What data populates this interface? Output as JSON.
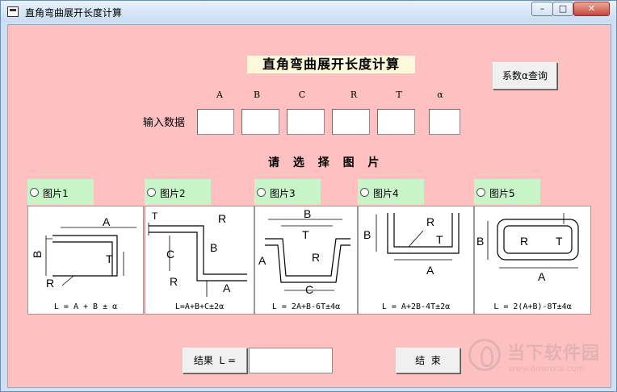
{
  "window": {
    "title": "直角弯曲展开长度计算",
    "min_glyph": "–",
    "max_glyph": "□",
    "close_glyph": "✕"
  },
  "form": {
    "heading": "直角弯曲展开长度计算",
    "query_button": "系数α查询",
    "column_labels": [
      "A",
      "B",
      "C",
      "R",
      "T",
      "α"
    ],
    "input_label": "输入数据",
    "inputs": [
      "",
      "",
      "",
      "",
      "",
      ""
    ],
    "subheading": "请 选 择 图 片",
    "pictures": [
      {
        "label": "图片1",
        "formula": "L = A + B ± α"
      },
      {
        "label": "图片2",
        "formula": "L=A+B+C±2α"
      },
      {
        "label": "图片3",
        "formula": "L = 2A+B-6T±4α"
      },
      {
        "label": "图片4",
        "formula": "L = A+2B-4T±2α"
      },
      {
        "label": "图片5",
        "formula": "L = 2(A+B)-8T±4α"
      }
    ],
    "result_button": "结果  L =",
    "result_value": "",
    "end_button": "结  束"
  },
  "watermark": {
    "brand": "当下软件园",
    "url": "www.downxia.com"
  }
}
